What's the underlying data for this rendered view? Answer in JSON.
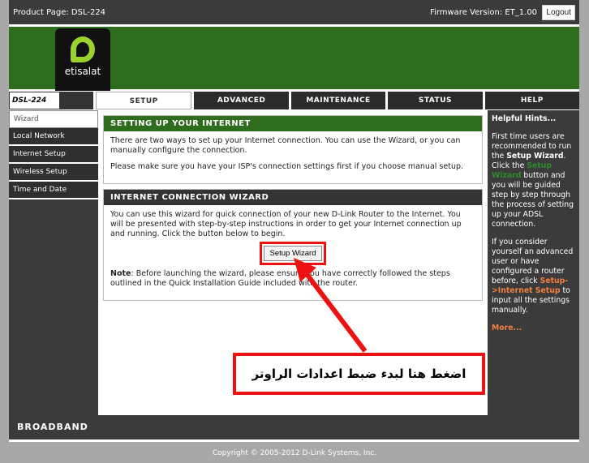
{
  "topbar": {
    "product": "Product Page: DSL-224",
    "firmware": "Firmware Version: ET_1.00",
    "logout": "Logout"
  },
  "logo": {
    "text": "etisalat"
  },
  "model": "DSL-224",
  "tabs": [
    {
      "label": "SETUP",
      "active": true
    },
    {
      "label": "ADVANCED"
    },
    {
      "label": "MAINTENANCE"
    },
    {
      "label": "STATUS"
    },
    {
      "label": "HELP"
    }
  ],
  "sidebar": {
    "items": [
      {
        "label": "Wizard"
      },
      {
        "label": "Local Network"
      },
      {
        "label": "Internet Setup"
      },
      {
        "label": "Wireless Setup"
      },
      {
        "label": "Time and Date"
      }
    ]
  },
  "main": {
    "section1": {
      "title": "SETTING UP YOUR INTERNET",
      "p1": "There are two ways to set up your Internet connection. You can use the Wizard, or you can manually configure the connection.",
      "p2": "Please make sure you have your ISP's connection settings first if you choose manual setup."
    },
    "section2": {
      "title": "INTERNET CONNECTION WIZARD",
      "p1": "You can use this wizard for quick connection of your new D-Link Router to the Internet. You will be presented with step-by-step instructions in order to get your Internet connection up and running. Click the button below to begin.",
      "button": "Setup Wizard",
      "note_label": "Note",
      "note": ": Before launching the wizard, please ensure you have correctly followed the steps outlined in the Quick Installation Guide included with the router."
    }
  },
  "hints": {
    "title": "Helpful Hints...",
    "p1a": "First time users are recommended to run the ",
    "p1b": "Setup Wizard",
    "p1c": ". Click the ",
    "p1d": "Setup Wizard",
    "p1e": " button and you will be guided step by step through the process of setting up your ADSL connection.",
    "p2a": "If you consider yourself an advanced user or have configured a router before, click ",
    "p2b": "Setup->Internet Setup",
    "p2c": " to input all the settings manually.",
    "more": "More..."
  },
  "footer": "BROADBAND",
  "copyright": "Copyright © 2005-2012 D-Link Systems, Inc.",
  "callout": "اضغط هنا لبدء ضبط اعدادات الراوتر",
  "colors": {
    "green": "#2f6d1e",
    "dark": "#3b3b3b",
    "highlight": "#e11111"
  }
}
